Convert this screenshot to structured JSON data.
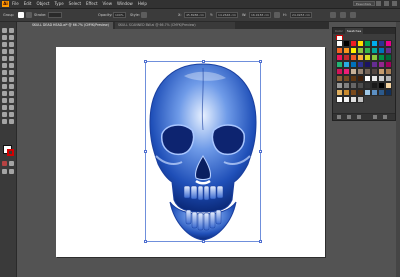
{
  "app": {
    "logo": "Ai",
    "menus": [
      "File",
      "Edit",
      "Object",
      "Type",
      "Select",
      "Effect",
      "View",
      "Window",
      "Help"
    ],
    "workspace": "Essentials"
  },
  "options_bar": {
    "selection_label": "Group",
    "stroke_label": "Stroke:",
    "opacity_label": "Opacity:",
    "opacity_value": "100%",
    "style_label": "Style:",
    "x_label": "X:",
    "x_value": "45.8986 cm",
    "y_label": "Y:",
    "y_value": "14.2646 cm",
    "w_label": "W:",
    "w_value": "16.9183 cm",
    "h_label": "H:",
    "h_value": "24.4953 cm"
  },
  "tabs": [
    {
      "label": "SKULL DEAD HEAD.ai* @ 66.7% (CMYK/Preview)"
    },
    {
      "label": "SKULL SCANNED BW.ai @ 66.7% (CMYK/Preview)"
    }
  ],
  "swatches_panel": {
    "tabs": [
      "Color",
      "Swatches"
    ],
    "active_tab": "Swatches",
    "colors": [
      "#ffffff",
      "#000000",
      "#ed1c24",
      "#ffde00",
      "#00a651",
      "#00aeef",
      "#2e3192",
      "#ec008c",
      "#f26522",
      "#f7941d",
      "#fff200",
      "#8dc63f",
      "#39b54a",
      "#00a99d",
      "#0072bc",
      "#662d91",
      "#ee145b",
      "#c1272d",
      "#f15a24",
      "#fbb03b",
      "#d9e021",
      "#8cc63f",
      "#009245",
      "#006837",
      "#22b573",
      "#29abe2",
      "#0071bc",
      "#2e3192",
      "#1b1464",
      "#662d91",
      "#93278f",
      "#9e005d",
      "#d4145a",
      "#ed1e79",
      "#c7b299",
      "#998675",
      "#736357",
      "#534741",
      "#c69c6d",
      "#a67c52",
      "#8c6239",
      "#754c24",
      "#603813",
      "#42210b",
      "#ffffff",
      "#e6e6e6",
      "#cccccc",
      "#b3b3b3",
      "#999999",
      "#808080",
      "#666666",
      "#4d4d4d",
      "#333333",
      "#1a1a1a",
      "#000000",
      "#f5d3a0",
      "#e0b060",
      "#c98a2e",
      "#7a4a1c",
      "#4a2b12",
      "#a0c8e6",
      "#5c8fc2",
      "#2c5a8c",
      "#12305a",
      "#ffffff",
      "#f2f2f2",
      "#e0e0e0",
      "#c0c0c0"
    ]
  },
  "document": {
    "artwork": "blue x-ray skull illustration"
  }
}
